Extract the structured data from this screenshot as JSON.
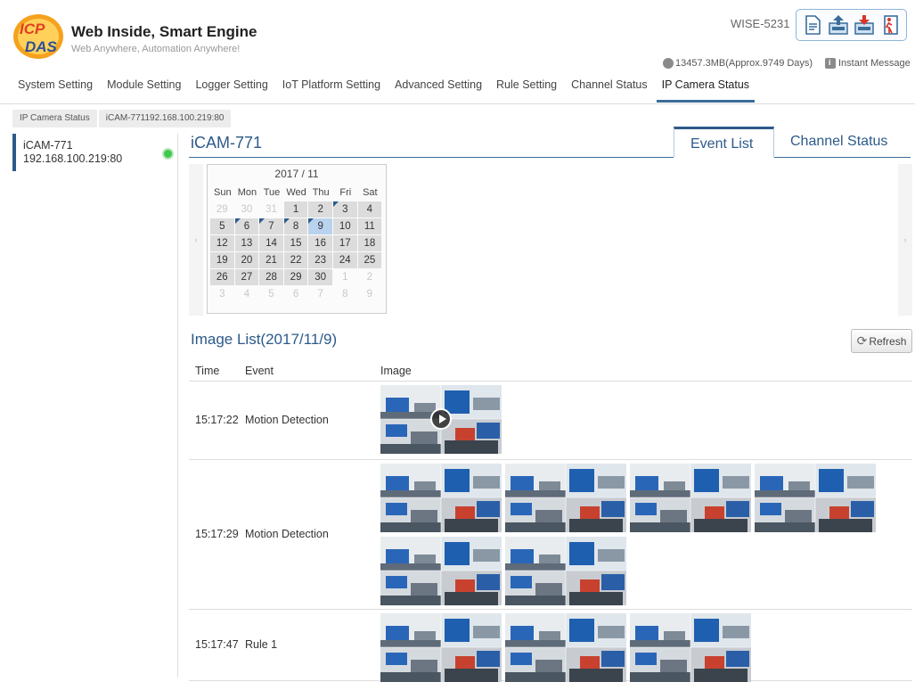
{
  "brand": {
    "title": "Web Inside, Smart Engine",
    "subtitle": "Web Anywhere, Automation Anywhere!",
    "logo_text": "ICP DAS"
  },
  "device": {
    "name": "WISE-5231",
    "storage": "13457.3MB(Approx.9749 Days)",
    "message_label": "Instant Message"
  },
  "toolbar": {
    "icons": [
      "document-icon",
      "upload-icon",
      "download-icon",
      "logout-icon"
    ]
  },
  "nav": {
    "items": [
      "System Setting",
      "Module Setting",
      "Logger Setting",
      "IoT Platform Setting",
      "Advanced Setting",
      "Rule Setting",
      "Channel Status",
      "IP Camera Status"
    ],
    "active": "IP Camera Status"
  },
  "breadcrumb": [
    "IP Camera Status",
    "iCAM-771192.168.100.219:80"
  ],
  "sidebar": {
    "camera_name": "iCAM-771",
    "camera_ip": "192.168.100.219:80",
    "status_color": "#3ec94c"
  },
  "main": {
    "title": "iCAM-771",
    "tabs": [
      "Event List",
      "Channel Status"
    ],
    "active_tab": "Event List"
  },
  "calendar": {
    "header": "2017 / 11",
    "dow": [
      "Sun",
      "Mon",
      "Tue",
      "Wed",
      "Thu",
      "Fri",
      "Sat"
    ],
    "weeks": [
      [
        "29",
        "30",
        "31",
        "1",
        "2",
        "3",
        "4"
      ],
      [
        "5",
        "6",
        "7",
        "8",
        "9",
        "10",
        "11"
      ],
      [
        "12",
        "13",
        "14",
        "15",
        "16",
        "17",
        "18"
      ],
      [
        "19",
        "20",
        "21",
        "22",
        "23",
        "24",
        "25"
      ],
      [
        "26",
        "27",
        "28",
        "29",
        "30",
        "1",
        "2"
      ],
      [
        "3",
        "4",
        "5",
        "6",
        "7",
        "8",
        "9"
      ]
    ],
    "selected": "9",
    "flagged_days": [
      "3",
      "6",
      "7",
      "8",
      "9"
    ]
  },
  "image_list": {
    "title": "Image List(2017/11/9)",
    "refresh_label": "Refresh",
    "columns": [
      "Time",
      "Event",
      "Image"
    ],
    "rows": [
      {
        "time": "15:17:22",
        "event": "Motion Detection",
        "images": 1,
        "video": true
      },
      {
        "time": "15:17:29",
        "event": "Motion Detection",
        "images": 6,
        "video": false
      },
      {
        "time": "15:17:47",
        "event": "Rule 1",
        "images": 3,
        "video": false
      }
    ]
  },
  "colors": {
    "accent": "#2c5a8a",
    "calendar_selected": "#b9d3ee",
    "status_ok": "#3ec94c"
  }
}
